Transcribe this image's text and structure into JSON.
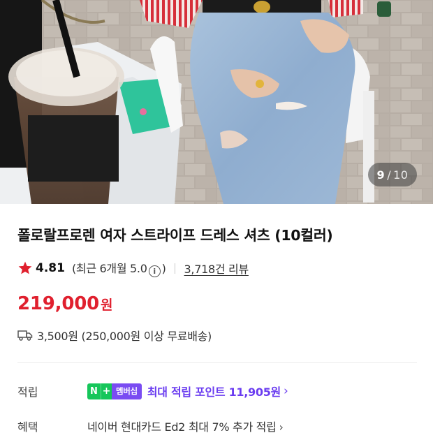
{
  "gallery": {
    "current": "9",
    "separator": "/",
    "total": "10"
  },
  "product": {
    "title": "폴로랄프로렌 여자 스트라이프 드레스 셔츠 (10컬러)",
    "rating": "4.81",
    "recent_rating": "(최근 6개월 5.0",
    "recent_close": ")",
    "info_glyph": "i",
    "review_count": "3,718건 리뷰",
    "price": "219,000",
    "price_unit": "원",
    "shipping": "3,500원 (250,000원 이상 무료배송)"
  },
  "points": {
    "label": "적립",
    "badge_n": "N",
    "badge_plus": "+",
    "badge_membership": "멤버십",
    "text": "최대 적립 포인트 11,905원",
    "chevron": "›"
  },
  "benefits": {
    "label": "혜택",
    "text": "네이버 현대카드 Ed2 최대 7% 추가 적립",
    "chevron": "›"
  },
  "colors": {
    "price": "#e0202e",
    "star": "#e0202e",
    "points": "#6a3cf0",
    "badge_green": "#16c65a",
    "badge_purple": "#7a4cf2"
  },
  "icons": {
    "star": "star-icon",
    "info": "info-icon",
    "truck": "truck-icon",
    "chevron": "chevron-right-icon"
  }
}
